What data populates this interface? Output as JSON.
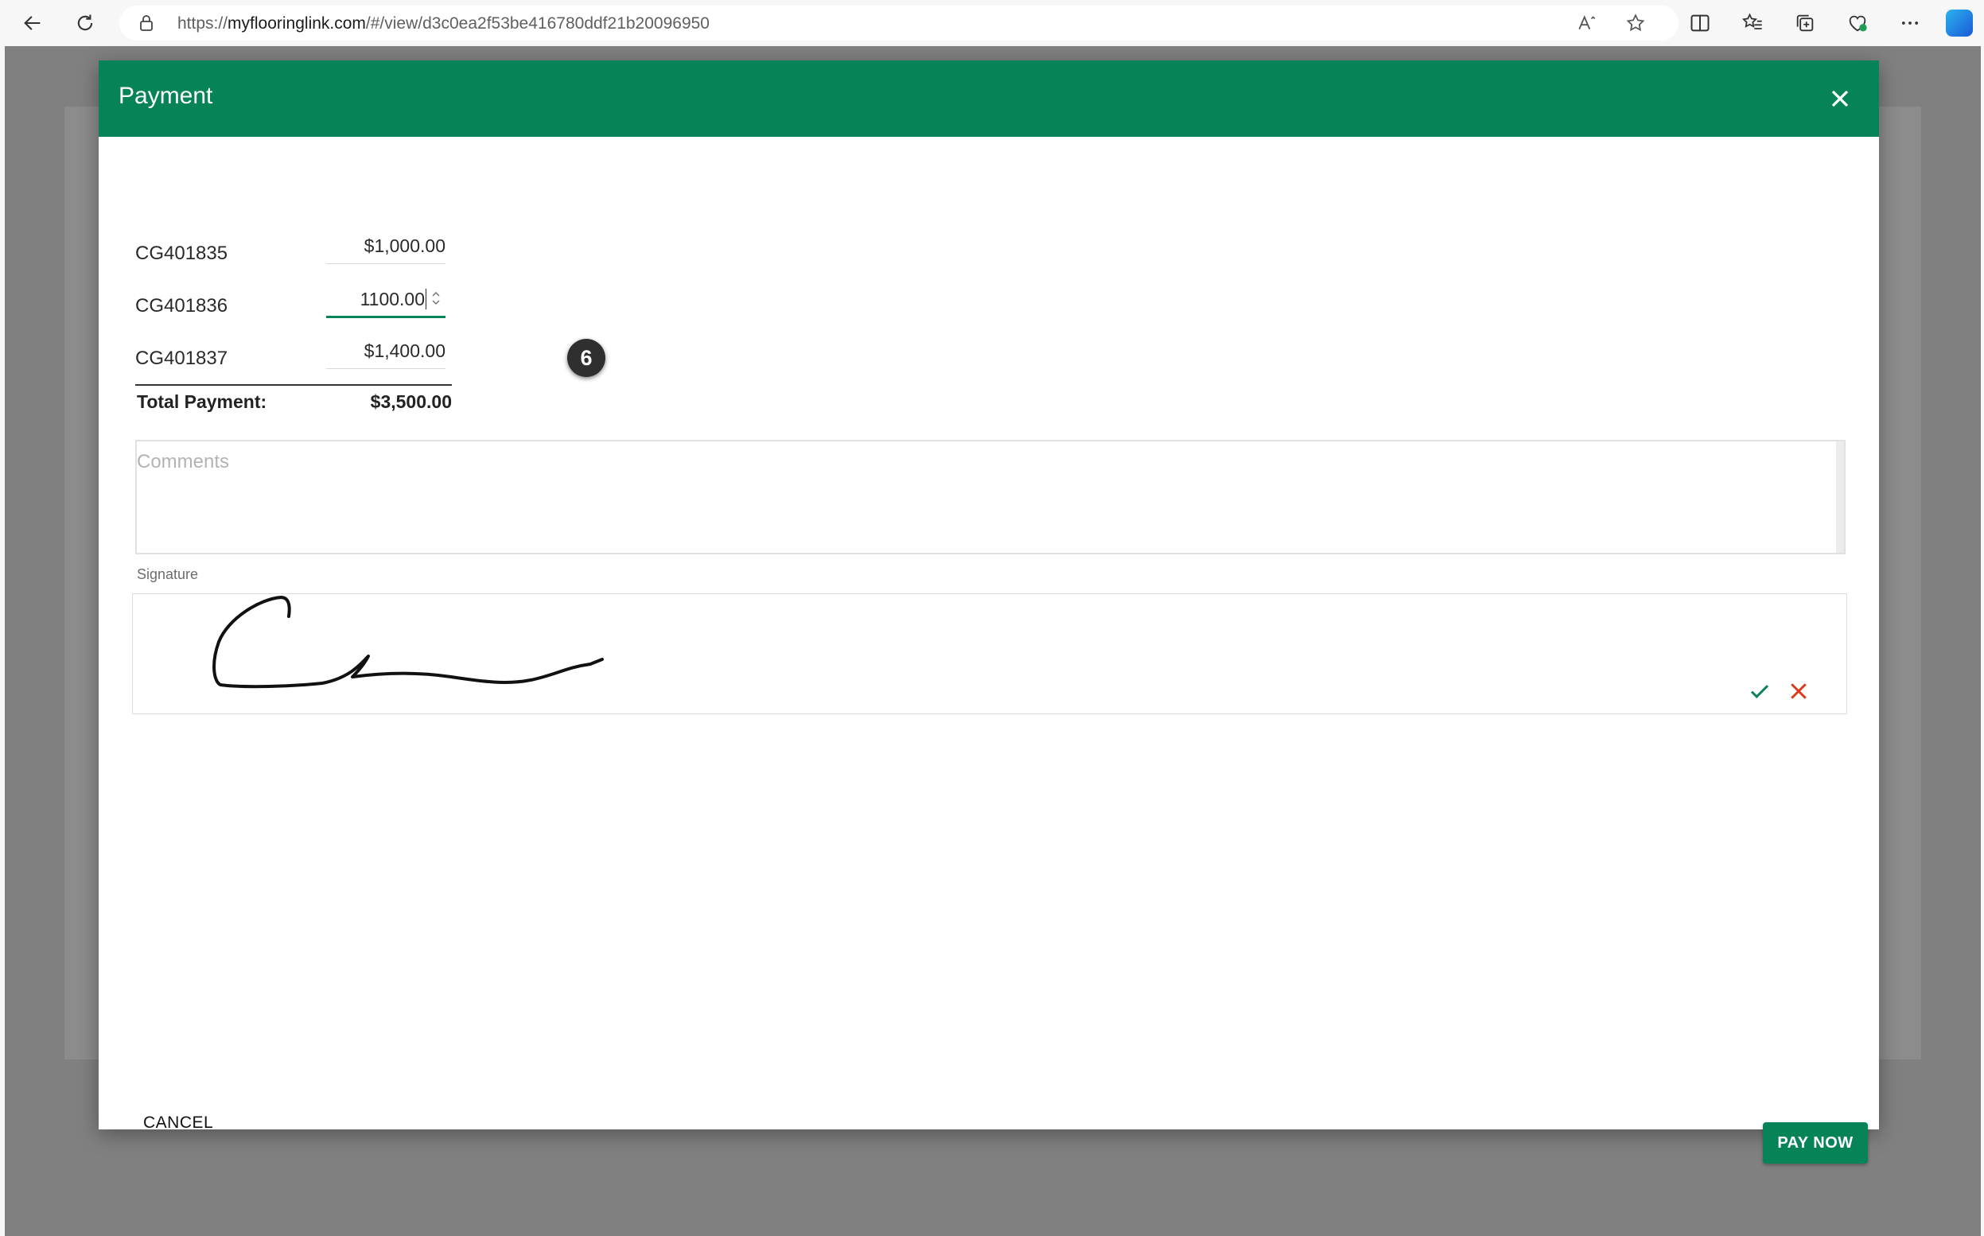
{
  "browser": {
    "url_prefix": "https://",
    "url_host": "myflooringlink.com",
    "url_path": "/#/view/d3c0ea2f53be416780ddf21b20096950",
    "icons": [
      "back-arrow-icon",
      "refresh-icon",
      "lock-icon",
      "read-aloud-icon",
      "favorite-star-icon",
      "split-screen-icon",
      "favorites-icon",
      "collections-icon",
      "browser-essentials-icon",
      "more-icon",
      "copilot-icon"
    ]
  },
  "dialog": {
    "title": "Payment",
    "payments": [
      {
        "invoice": "CG401835",
        "amount": "$1,000.00"
      },
      {
        "invoice": "CG401836",
        "amount": "1100.00"
      },
      {
        "invoice": "CG401837",
        "amount": "$1,400.00"
      }
    ],
    "step_badge": "6",
    "total_label": "Total Payment:",
    "total_value": "$3,500.00",
    "comments_placeholder": "Comments",
    "signature_label": "Signature",
    "cancel_label": "CANCEL",
    "pay_label": "PAY NOW"
  },
  "colors": {
    "header_green": "#068457",
    "overlay": "#808080",
    "clear_red": "#d93a1a"
  }
}
